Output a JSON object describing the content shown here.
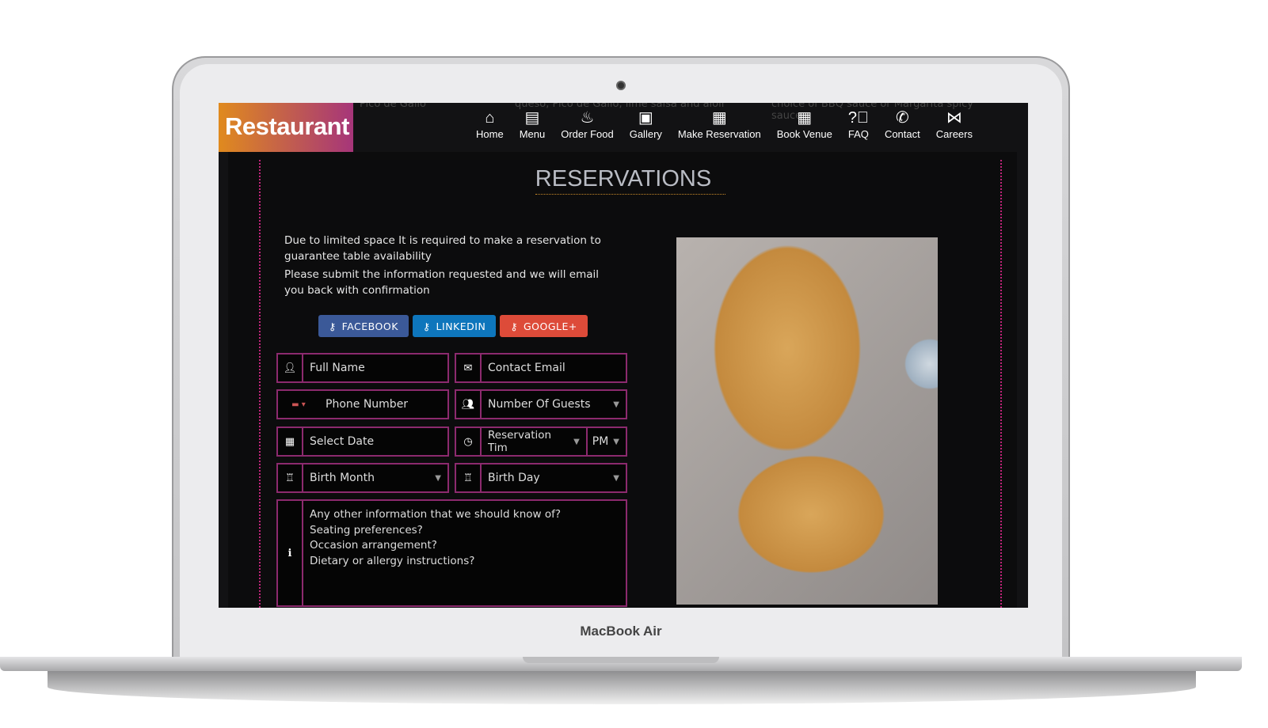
{
  "device": {
    "brand": "MacBook Air"
  },
  "header": {
    "logo": "Restaurant",
    "background_snippets": [
      "Pico de Gallo",
      "queso, Pico de Gallo, lime salsa and aioli",
      "choice of BBQ sauce or Margarita spicy sauce"
    ],
    "nav": [
      {
        "label": "Home",
        "icon": "home-icon"
      },
      {
        "label": "Menu",
        "icon": "menu-icon"
      },
      {
        "label": "Order Food",
        "icon": "bell-icon"
      },
      {
        "label": "Gallery",
        "icon": "image-icon"
      },
      {
        "label": "Make Reservation",
        "icon": "calendar-icon"
      },
      {
        "label": "Book Venue",
        "icon": "calendar-check-icon"
      },
      {
        "label": "FAQ",
        "icon": "question-icon"
      },
      {
        "label": "Contact",
        "icon": "phone-icon"
      },
      {
        "label": "Careers",
        "icon": "careers-icon"
      }
    ]
  },
  "page": {
    "title": "RESERVATIONS",
    "intro": [
      "Due to limited space It is required to make a reservation to guarantee table availability",
      "Please submit the information requested and we will email you back with confirmation"
    ],
    "social": [
      {
        "label": "FACEBOOK",
        "color": "#3b5998"
      },
      {
        "label": "LINKEDIN",
        "color": "#0e76bc"
      },
      {
        "label": "GOOGLE+",
        "color": "#dd4b39"
      }
    ],
    "form": {
      "full_name": "Full Name",
      "email": "Contact Email",
      "phone": "Phone Number",
      "guests": "Number Of Guests",
      "date": "Select Date",
      "time": "Reservation Tim",
      "ampm": "PM",
      "birth_month": "Birth Month",
      "birth_day": "Birth Day",
      "notes": [
        "Any other information that we should know of?",
        "Seating preferences?",
        "Occasion arrangement?",
        "Dietary or allergy instructions?"
      ]
    }
  },
  "colors": {
    "accent": "#8c2a6e",
    "dotted": "#c0247a"
  }
}
